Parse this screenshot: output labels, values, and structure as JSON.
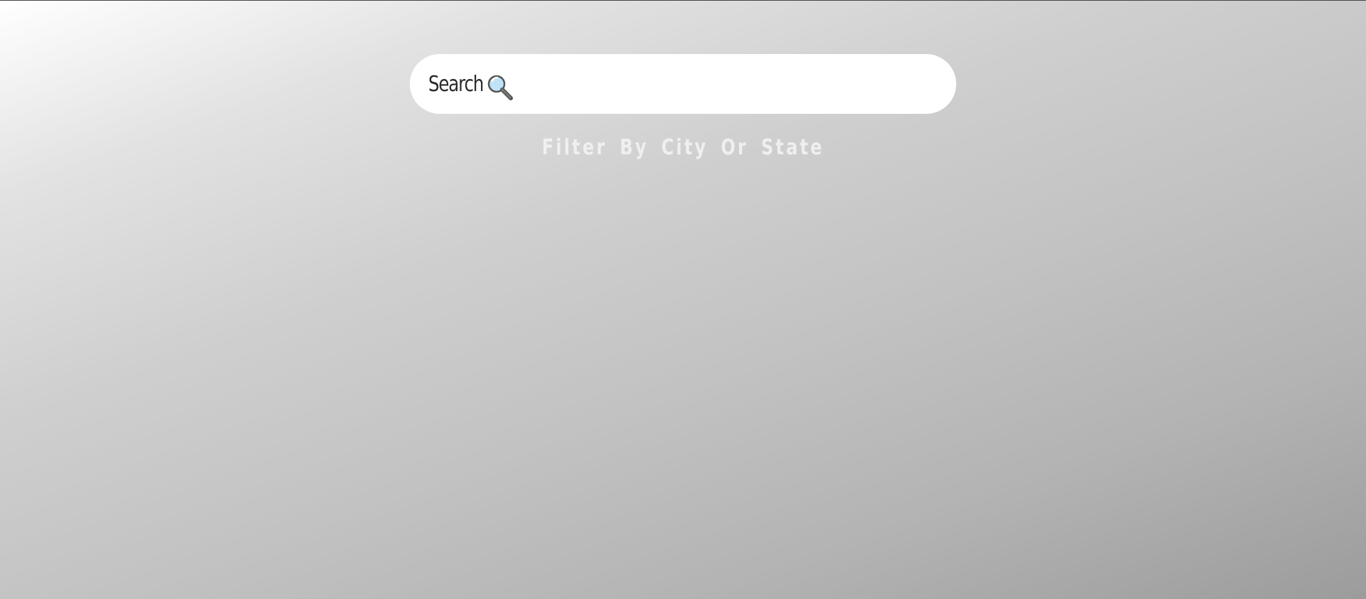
{
  "search": {
    "label": "Search",
    "icon": "magnifying-glass-icon",
    "value": "",
    "placeholder": ""
  },
  "hint": {
    "text": "Filter By City Or State"
  },
  "colors": {
    "gradient_start": "#ffffff",
    "gradient_end": "#9c9c9c",
    "search_bg": "#ffffff",
    "label_text": "#2b2b2b",
    "hint_text": "#f5f5f5"
  }
}
